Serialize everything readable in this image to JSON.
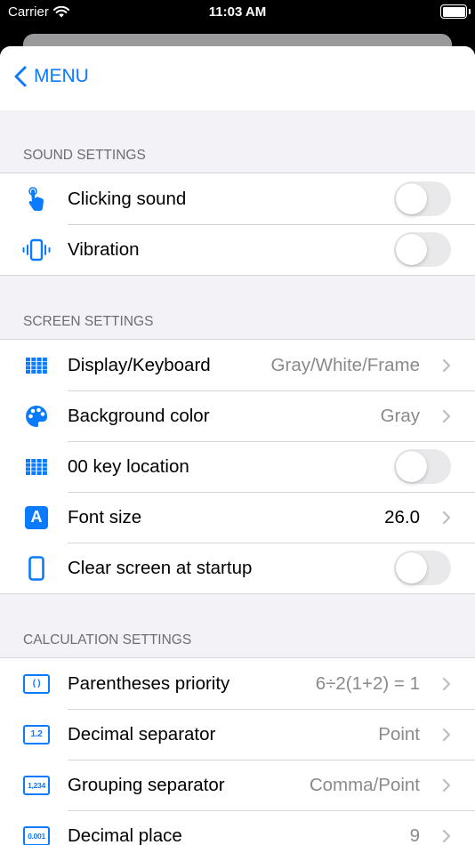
{
  "status_bar": {
    "carrier": "Carrier",
    "time": "11:03 AM"
  },
  "nav": {
    "back_label": "MENU"
  },
  "sections": {
    "sound": {
      "header": "SOUND SETTINGS",
      "clicking_sound": {
        "label": "Clicking sound",
        "enabled": false
      },
      "vibration": {
        "label": "Vibration",
        "enabled": false
      }
    },
    "screen": {
      "header": "SCREEN SETTINGS",
      "display_keyboard": {
        "label": "Display/Keyboard",
        "value": "Gray/White/Frame"
      },
      "background_color": {
        "label": "Background color",
        "value": "Gray"
      },
      "key_00_location": {
        "label": "00 key location",
        "enabled": false
      },
      "font_size": {
        "label": "Font size",
        "value": "26.0"
      },
      "clear_screen": {
        "label": "Clear screen at startup",
        "enabled": false
      }
    },
    "calculation": {
      "header": "CALCULATION SETTINGS",
      "parentheses_priority": {
        "label": "Parentheses priority",
        "value": "6÷2(1+2) = 1",
        "icon_text": "( )"
      },
      "decimal_separator": {
        "label": "Decimal separator",
        "value": "Point",
        "icon_text": "1.2"
      },
      "grouping_separator": {
        "label": "Grouping separator",
        "value": "Comma/Point",
        "icon_text": "1,234"
      },
      "decimal_place": {
        "label": "Decimal place",
        "value": "9",
        "icon_text": "0.001"
      }
    }
  },
  "colors": {
    "accent": "#0a7aff",
    "secondary_text": "#8a8a8e",
    "group_background": "#f2f2f7"
  }
}
